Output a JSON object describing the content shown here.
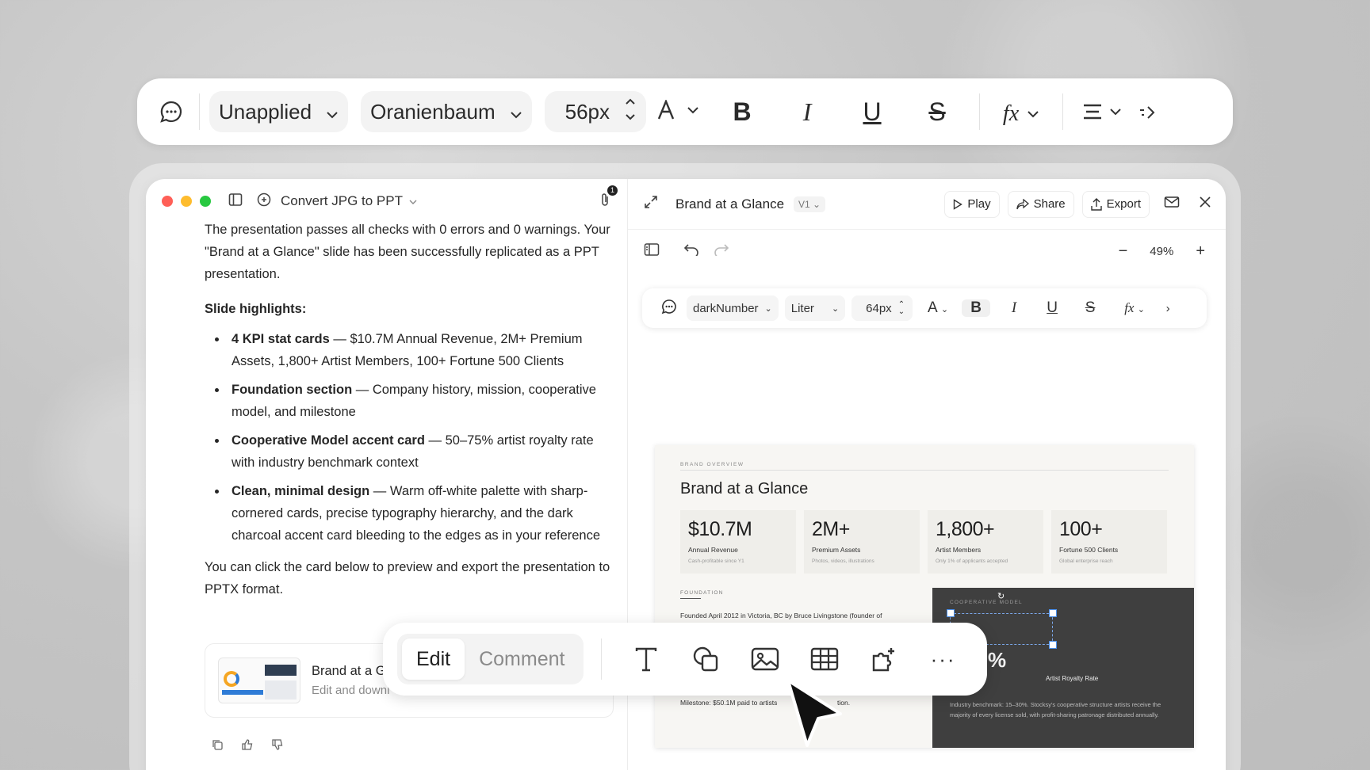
{
  "toolbar": {
    "style_select": "Unapplied",
    "font_select": "Oranienbaum",
    "font_size": "56px"
  },
  "chat": {
    "title": "Convert JPG to PPT",
    "attachment_badge": "1",
    "intro": "The presentation passes all checks with 0 errors and 0 warnings. Your \"Brand at a Glance\" slide has been successfully replicated as a PPT presentation.",
    "highlights_heading": "Slide highlights:",
    "highlights": [
      {
        "title": "4 KPI stat cards",
        "text": " — $10.7M Annual Revenue, 2M+ Premium Assets, 1,800+ Artist Members, 100+ Fortune 500 Clients"
      },
      {
        "title": "Foundation section",
        "text": " — Company history, mission, cooperative model, and milestone"
      },
      {
        "title": "Cooperative Model accent card",
        "text": " — 50–75% artist royalty rate with industry benchmark context"
      },
      {
        "title": "Clean, minimal design",
        "text": " — Warm off-white palette with sharp-cornered cards, precise typography hierarchy, and the dark charcoal accent card bleeding to the edges as in your reference"
      }
    ],
    "outro": "You can click the card below to preview and export the presentation to PPTX format.",
    "card_title": "Brand at a G",
    "card_subtitle": "Edit and downl"
  },
  "editor": {
    "doc_title": "Brand at a Glance",
    "version": "V1",
    "play": "Play",
    "share": "Share",
    "export": "Export",
    "zoom": "49%",
    "mini_toolbar": {
      "style": "darkNumber",
      "font": "Liter",
      "size": "64px"
    }
  },
  "slide": {
    "eyebrow": "BRAND OVERVIEW",
    "title": "Brand at a Glance",
    "kpis": [
      {
        "value": "$10.7M",
        "label": "Annual Revenue",
        "sub": "Cash-profitable since Y1"
      },
      {
        "value": "2M+",
        "label": "Premium Assets",
        "sub": "Photos, videos, illustrations"
      },
      {
        "value": "1,800+",
        "label": "Artist Members",
        "sub": "Only 1% of applicants accepted"
      },
      {
        "value": "100+",
        "label": "Fortune 500 Clients",
        "sub": "Global enterprise reach"
      }
    ],
    "foundation_label": "FOUNDATION",
    "foundation_text": "Founded April 2012 in Victoria, BC by Bruce Livingstone (founder of",
    "milestone_text": "Milestone: $50.1M paid to artists",
    "milestone_tail": "tion.",
    "coop_label": "COOPERATIVE MODEL",
    "coop_value_suffix": "%",
    "royalty_label": "Artist Royalty Rate",
    "benchmark_text": "Industry benchmark: 15–30%. Stocksy's cooperative structure artists receive the majority of every license sold, with profit-sharing patronage distributed annually."
  },
  "float_toolbar": {
    "edit": "Edit",
    "comment": "Comment"
  }
}
